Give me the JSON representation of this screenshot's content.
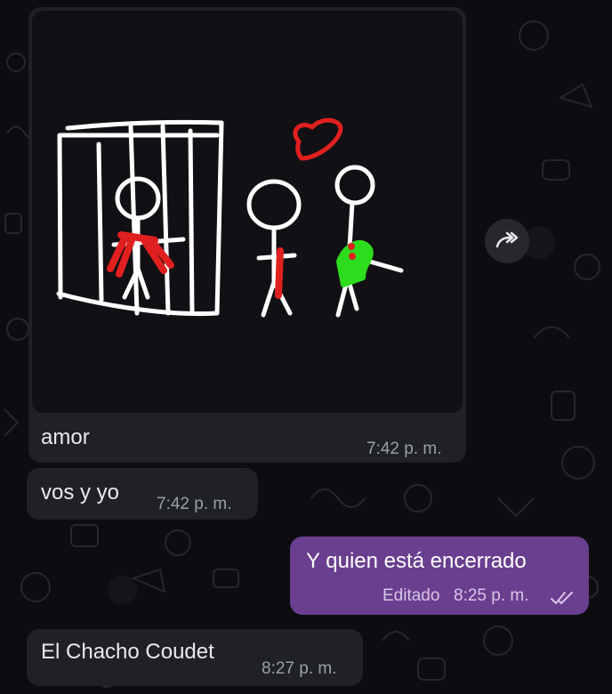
{
  "messages": [
    {
      "direction": "incoming",
      "type": "image",
      "caption": "amor",
      "time": "7:42 p. m."
    },
    {
      "direction": "incoming",
      "type": "text",
      "text": "vos y yo",
      "time": "7:42 p. m."
    },
    {
      "direction": "outgoing",
      "type": "text",
      "text": "Y quien está encerrado",
      "edited_label": "Editado",
      "time": "8:25 p. m.",
      "status": "read"
    },
    {
      "direction": "incoming",
      "type": "text",
      "text": "El Chacho Coudet",
      "time": "8:27 p. m."
    }
  ],
  "colors": {
    "background": "#0c0c0e",
    "incoming_bubble": "#1f2125",
    "outgoing_bubble": "#6a3f8f",
    "drawing_white": "#ffffff",
    "drawing_red": "#e0201f",
    "drawing_green": "#2ddc1d"
  },
  "icons": {
    "forward": "forward-icon",
    "read_status": "double-check-icon"
  }
}
